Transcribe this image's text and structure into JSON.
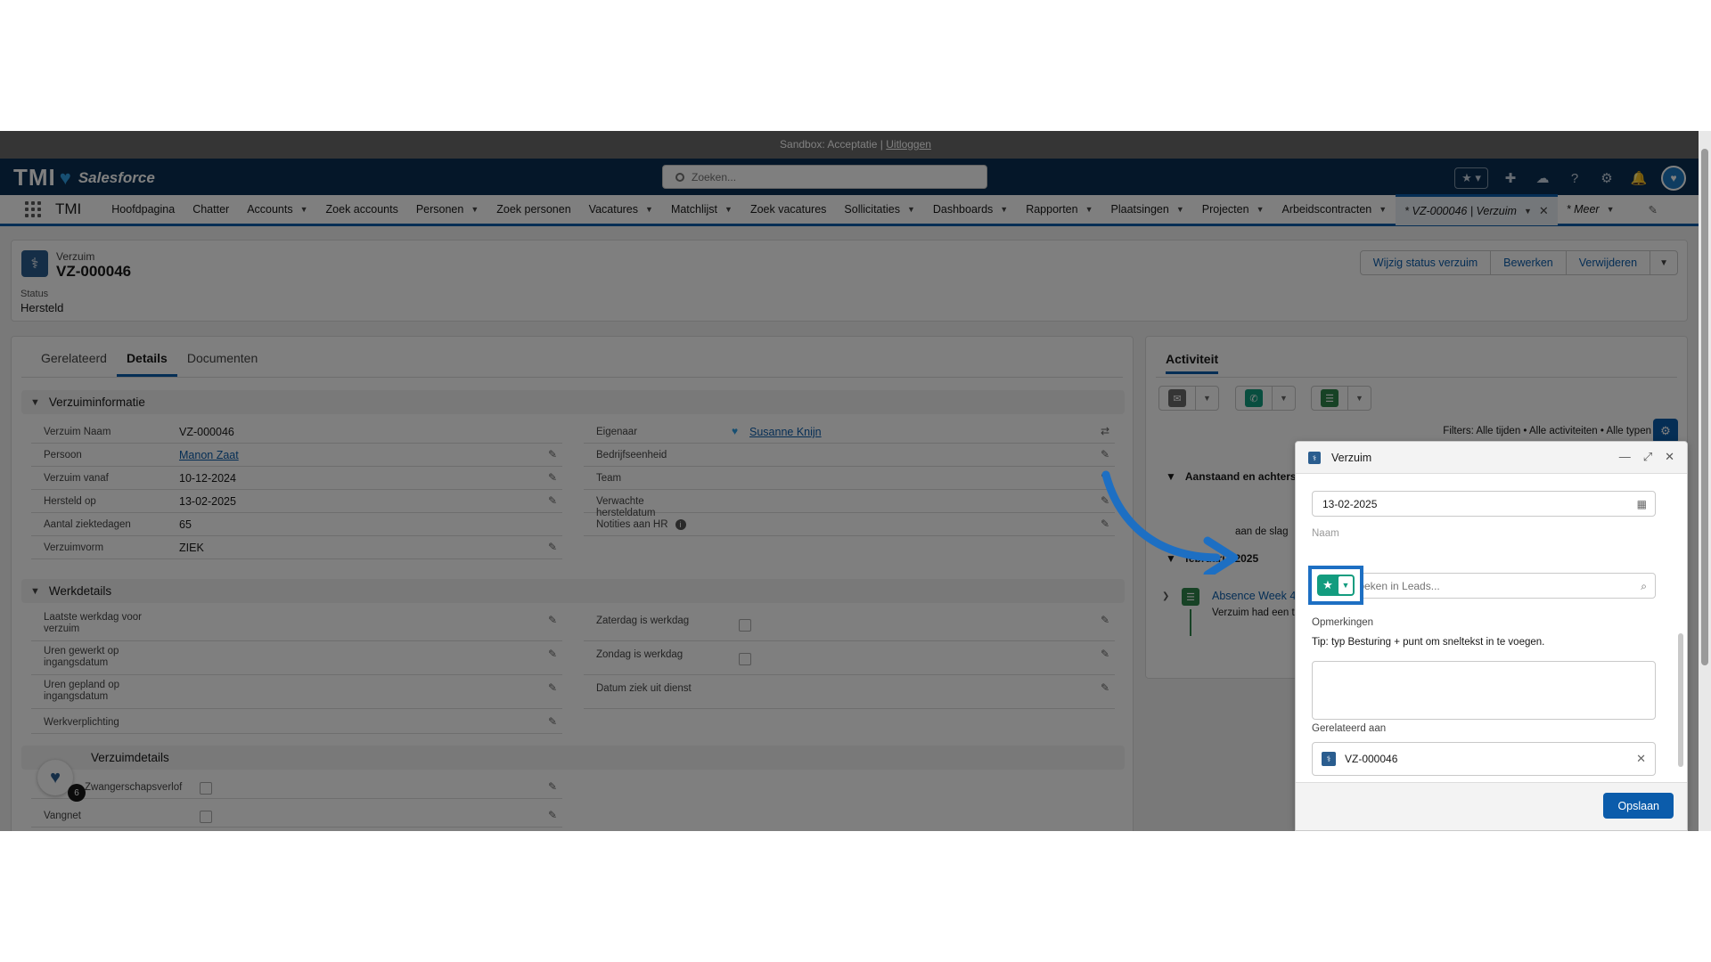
{
  "sandbox": {
    "text": "Sandbox: Acceptatie |",
    "logout": "Uitloggen"
  },
  "header": {
    "logo": "TMI",
    "brand": "Salesforce",
    "search_placeholder": "Zoeken..."
  },
  "nav": {
    "app": "TMI",
    "items": [
      "Hoofdpagina",
      "Chatter",
      "Accounts",
      "Zoek accounts",
      "Personen",
      "Zoek personen",
      "Vacatures",
      "Matchlijst",
      "Zoek vacatures",
      "Sollicitaties",
      "Dashboards",
      "Rapporten",
      "Plaatsingen",
      "Projecten",
      "Arbeidscontracten"
    ],
    "active_tab": "* VZ-000046 | Verzuim",
    "more": "* Meer"
  },
  "record": {
    "type": "Verzuim",
    "name": "VZ-000046",
    "status_label": "Status",
    "status_value": "Hersteld",
    "buttons": [
      "Wijzig status verzuim",
      "Bewerken",
      "Verwijderen"
    ]
  },
  "tabs": [
    "Gerelateerd",
    "Details",
    "Documenten"
  ],
  "sections": {
    "info": "Verzuiminformatie",
    "work": "Werkdetails",
    "third": "Verzuimdetails"
  },
  "fields": {
    "naam_l": "Verzuim Naam",
    "naam_v": "VZ-000046",
    "persoon_l": "Persoon",
    "persoon_v": "Manon Zaat",
    "vanaf_l": "Verzuim vanaf",
    "vanaf_v": "10-12-2024",
    "hersteld_l": "Hersteld op",
    "hersteld_v": "13-02-2025",
    "dagen_l": "Aantal ziektedagen",
    "dagen_v": "65",
    "vorm_l": "Verzuimvorm",
    "vorm_v": "ZIEK",
    "eigenaar_l": "Eigenaar",
    "eigenaar_v": "Susanne Knijn",
    "bedrijf_l": "Bedrijfseenheid",
    "team_l": "Team",
    "verwacht_l": "Verwachte hersteldatum",
    "notities_l": "Notities aan HR",
    "laatste_l": "Laatste werkdag voor verzuim",
    "zaterdag_l": "Zaterdag is werkdag",
    "gewerkt_l": "Uren gewerkt op ingangsdatum",
    "zondag_l": "Zondag is werkdag",
    "gepland_l": "Uren gepland op ingangsdatum",
    "datumziek_l": "Datum ziek uit dienst",
    "werkverpl_l": "Werkverplichting",
    "zwanger_l": "Zwangerschapsverlof",
    "vangnet_l": "Vangnet"
  },
  "activity": {
    "title": "Activiteit",
    "filters": "Filters: Alle tijden • Alle activiteiten • Alle typen",
    "upcoming": "Aanstaand en achterstallig",
    "slag": "aan de slag",
    "month": "februari • 2025",
    "item_title": "Absence Week 4",
    "item_desc": "Verzuim had een taak"
  },
  "composer": {
    "title": "Verzuim",
    "date": "13-02-2025",
    "name_label": "Naam",
    "search_placeholder": "Zoeken in Leads...",
    "remarks_label": "Opmerkingen",
    "tip": "Tip: typ Besturing + punt om sneltekst in te voegen.",
    "related_label": "Gerelateerd aan",
    "related_value": "VZ-000046",
    "save": "Opslaan"
  },
  "utility": {
    "badge": "6"
  },
  "colors": {
    "header": "#0b2f52",
    "brand_blue": "#0b5cab",
    "highlight": "#1d6fc3",
    "lead_green": "#139c7f"
  }
}
